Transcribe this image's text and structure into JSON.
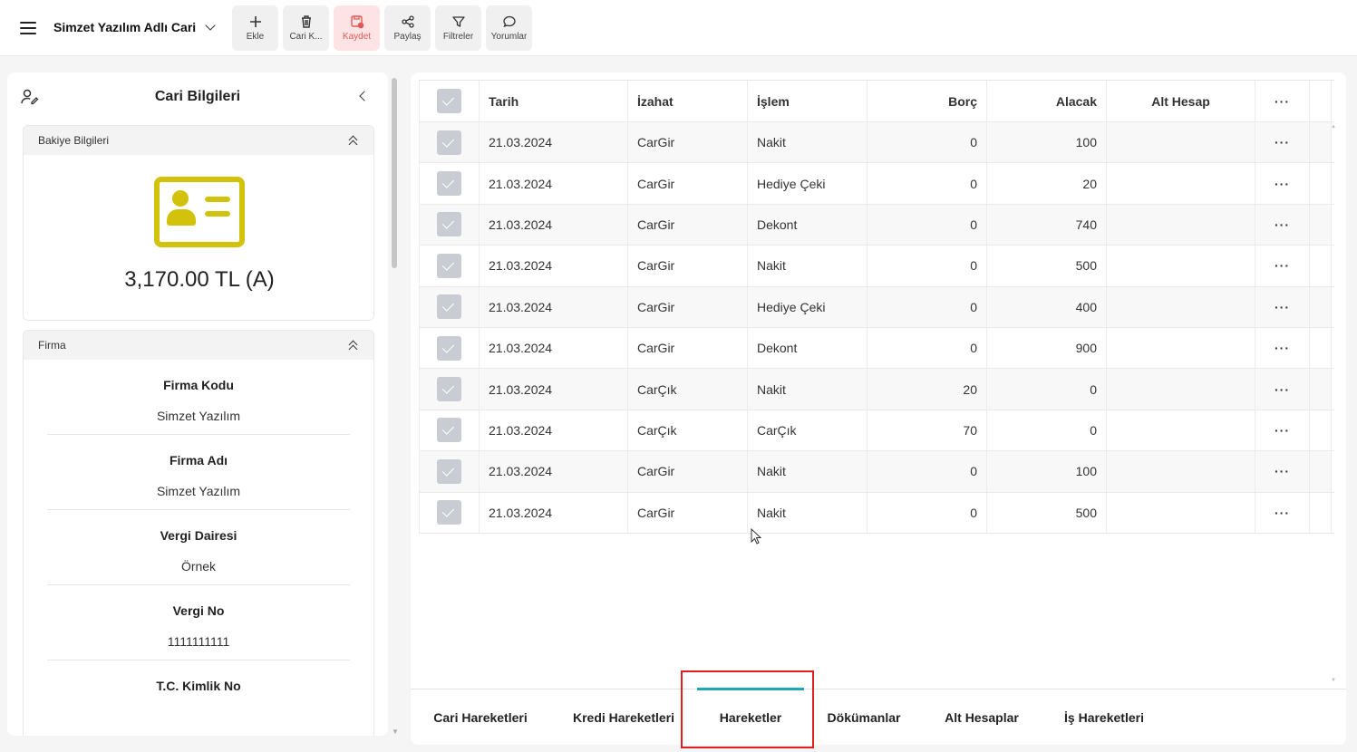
{
  "app": {
    "title": "Simzet Yazılım Adlı Cari"
  },
  "toolbar": [
    {
      "label": "Ekle",
      "icon": "plus-icon"
    },
    {
      "label": "Cari K...",
      "icon": "trash-icon"
    },
    {
      "label": "Kaydet",
      "icon": "save-icon"
    },
    {
      "label": "Paylaş",
      "icon": "share-icon"
    },
    {
      "label": "Filtreler",
      "icon": "filter-icon"
    },
    {
      "label": "Yorumlar",
      "icon": "comment-icon"
    }
  ],
  "left_panel": {
    "title": "Cari Bilgileri",
    "balance_section": {
      "title": "Bakiye Bilgileri",
      "balance": "3,170.00 TL (A)",
      "accent": "#d2c20b"
    },
    "firm_section": {
      "title": "Firma",
      "fields": [
        {
          "label": "Firma Kodu",
          "value": "Simzet Yazılım"
        },
        {
          "label": "Firma Adı",
          "value": "Simzet Yazılım"
        },
        {
          "label": "Vergi Dairesi",
          "value": "Örnek"
        },
        {
          "label": "Vergi No",
          "value": "1111111111"
        },
        {
          "label": "T.C. Kimlik No",
          "value": ""
        }
      ]
    }
  },
  "grid": {
    "columns": {
      "tarih": "Tarih",
      "izahat": "İzahat",
      "islem": "İşlem",
      "borc": "Borç",
      "alacak": "Alacak",
      "alt_hesap": "Alt Hesap",
      "more": "···"
    },
    "rows": [
      {
        "tarih": "21.03.2024",
        "izahat": "CarGir",
        "islem": "Nakit",
        "borc": "0",
        "alacak": "100"
      },
      {
        "tarih": "21.03.2024",
        "izahat": "CarGir",
        "islem": "Hediye Çeki",
        "borc": "0",
        "alacak": "20"
      },
      {
        "tarih": "21.03.2024",
        "izahat": "CarGir",
        "islem": "Dekont",
        "borc": "0",
        "alacak": "740"
      },
      {
        "tarih": "21.03.2024",
        "izahat": "CarGir",
        "islem": "Nakit",
        "borc": "0",
        "alacak": "500"
      },
      {
        "tarih": "21.03.2024",
        "izahat": "CarGir",
        "islem": "Hediye Çeki",
        "borc": "0",
        "alacak": "400"
      },
      {
        "tarih": "21.03.2024",
        "izahat": "CarGir",
        "islem": "Dekont",
        "borc": "0",
        "alacak": "900"
      },
      {
        "tarih": "21.03.2024",
        "izahat": "CarÇık",
        "islem": "Nakit",
        "borc": "20",
        "alacak": "0"
      },
      {
        "tarih": "21.03.2024",
        "izahat": "CarÇık",
        "islem": "CarÇık",
        "borc": "70",
        "alacak": "0"
      },
      {
        "tarih": "21.03.2024",
        "izahat": "CarGir",
        "islem": "Nakit",
        "borc": "0",
        "alacak": "100"
      },
      {
        "tarih": "21.03.2024",
        "izahat": "CarGir",
        "islem": "Nakit",
        "borc": "0",
        "alacak": "500"
      }
    ]
  },
  "tabs": [
    {
      "label": "Cari Hareketleri",
      "active": false
    },
    {
      "label": "Kredi Hareketleri",
      "active": false
    },
    {
      "label": "Hareketler",
      "active": true
    },
    {
      "label": "Dökümanlar",
      "active": false
    },
    {
      "label": "Alt Hesaplar",
      "active": false
    },
    {
      "label": "İş Hareketleri",
      "active": false
    }
  ],
  "colors": {
    "accent_tab": "#1ba7b5",
    "highlight": "#e21f1f",
    "save": "#e05a5a"
  }
}
